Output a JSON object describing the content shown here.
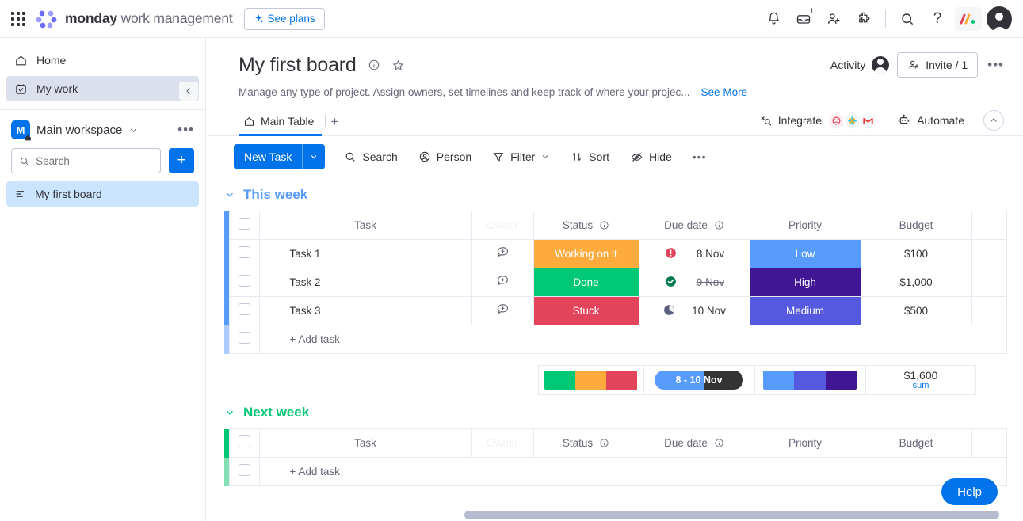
{
  "topbar": {
    "brand_bold": "monday",
    "brand_light": " work management",
    "see_plans": "See plans",
    "icons": {
      "apps": "apps-grid-icon",
      "notifications": "bell-icon",
      "inbox": "inbox-icon",
      "invite": "invite-member-icon",
      "extensions": "puzzle-icon",
      "search": "search-icon",
      "help": "question-mark-icon",
      "monday_mini": "monday-logo-icon",
      "avatar": "user-avatar"
    },
    "inbox_badge": "1"
  },
  "sidebar": {
    "nav": [
      {
        "label": "Home",
        "icon": "home-icon"
      },
      {
        "label": "My work",
        "icon": "my-work-calendar-icon"
      }
    ],
    "workspace": {
      "initial": "M",
      "name": "Main workspace"
    },
    "search_placeholder": "Search",
    "add_label": "+",
    "boards": [
      {
        "label": "My first board",
        "icon": "board-lines-icon"
      }
    ]
  },
  "board": {
    "title": "My first board",
    "description": "Manage any type of project. Assign owners, set timelines and keep track of where your projec...",
    "see_more": "See More",
    "activity_label": "Activity",
    "invite_label": "Invite / 1",
    "tabs": [
      {
        "label": "Main Table",
        "icon": "home-icon"
      }
    ],
    "add_tab": "+",
    "integrate_label": "Integrate",
    "automate_label": "Automate",
    "toolbar": {
      "new_task": "New Task",
      "search": "Search",
      "person": "Person",
      "filter": "Filter",
      "sort": "Sort",
      "hide": "Hide",
      "more": "•••"
    },
    "columns": [
      "Task",
      "Owner",
      "Status",
      "Due date",
      "Priority",
      "Budget"
    ],
    "groups": [
      {
        "name": "This week",
        "color": "#579bfc",
        "rows": [
          {
            "task": "Task 1",
            "status": "Working on it",
            "status_color": "#fdab3d",
            "due": "8 Nov",
            "due_struck": false,
            "due_icon": "alert-icon",
            "due_icon_color": "#e2445c",
            "priority": "Low",
            "priority_color": "#579bfc",
            "budget": "$100"
          },
          {
            "task": "Task 2",
            "status": "Done",
            "status_color": "#00c875",
            "due": "9 Nov",
            "due_struck": true,
            "due_icon": "check-icon",
            "due_icon_color": "#007a4e",
            "priority": "High",
            "priority_color": "#401694",
            "budget": "$1,000"
          },
          {
            "task": "Task 3",
            "status": "Stuck",
            "status_color": "#e2445c",
            "due": "10 Nov",
            "due_struck": false,
            "due_icon": "pie-clock-icon",
            "due_icon_color": "#5a5f7d",
            "priority": "Medium",
            "priority_color": "#5559df",
            "budget": "$500"
          }
        ],
        "add_task": "+ Add task",
        "summary": {
          "status_segments": [
            "#00c875",
            "#fdab3d",
            "#e2445c"
          ],
          "date_range": "8 - 10 Nov",
          "priority_segments": [
            "#579bfc",
            "#5559df",
            "#401694"
          ],
          "budget_total": "$1,600",
          "budget_label": "sum"
        }
      },
      {
        "name": "Next week",
        "color": "#00c875",
        "rows": [],
        "add_task": "+ Add task"
      }
    ]
  },
  "help_button": "Help"
}
